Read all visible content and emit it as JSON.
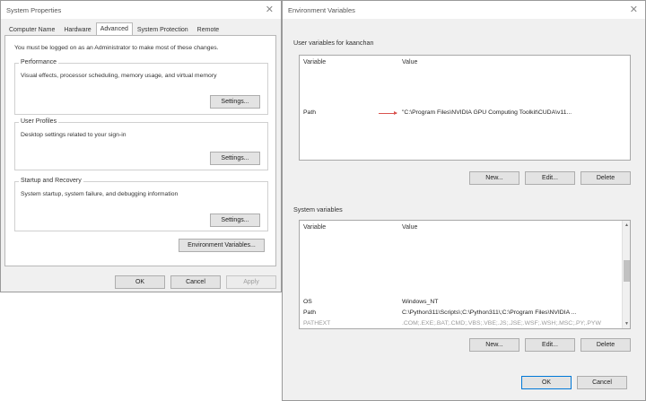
{
  "system_properties": {
    "title": "System Properties",
    "close_glyph": "✕",
    "tabs": [
      {
        "label": "Computer Name"
      },
      {
        "label": "Hardware"
      },
      {
        "label": "Advanced"
      },
      {
        "label": "System Protection"
      },
      {
        "label": "Remote"
      }
    ],
    "notice": "You must be logged on as an Administrator to make most of these changes.",
    "performance": {
      "title": "Performance",
      "description": "Visual effects, processor scheduling, memory usage, and virtual memory",
      "button": "Settings..."
    },
    "user_profiles": {
      "title": "User Profiles",
      "description": "Desktop settings related to your sign-in",
      "button": "Settings..."
    },
    "startup_recovery": {
      "title": "Startup and Recovery",
      "description": "System startup, system failure, and debugging information",
      "button": "Settings..."
    },
    "env_button": "Environment Variables...",
    "ok": "OK",
    "cancel": "Cancel",
    "apply": "Apply"
  },
  "environment_variables": {
    "title": "Environment Variables",
    "close_glyph": "✕",
    "user_section": {
      "label": "User variables for kaanchan",
      "columns": {
        "variable": "Variable",
        "value": "Value"
      },
      "rows": [
        {
          "variable": "Path",
          "value": "\"C:\\Program Files\\NVIDIA GPU Computing Toolkit\\CUDA\\v11..."
        }
      ],
      "new": "New...",
      "edit": "Edit...",
      "delete": "Delete"
    },
    "system_section": {
      "label": "System variables",
      "columns": {
        "variable": "Variable",
        "value": "Value"
      },
      "rows": [
        {
          "variable": "OS",
          "value": "Windows_NT"
        },
        {
          "variable": "Path",
          "value": "C:\\Python311\\Scripts\\;C:\\Python311\\;C:\\Program Files\\NVIDIA ..."
        },
        {
          "variable": "PATHEXT",
          "value": ".COM;.EXE;.BAT;.CMD;.VBS;.VBE;.JS;.JSE;.WSF;.WSH;.MSC;.PY;.PYW"
        }
      ],
      "new": "New...",
      "edit": "Edit...",
      "delete": "Delete"
    },
    "ok": "OK",
    "cancel": "Cancel"
  }
}
